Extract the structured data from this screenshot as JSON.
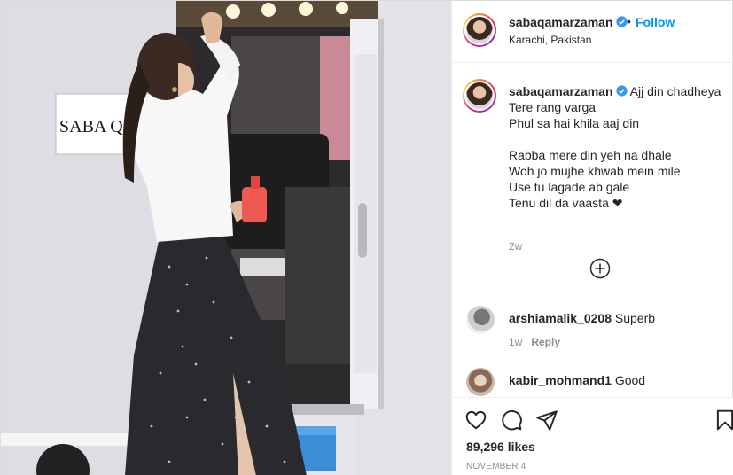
{
  "header": {
    "username": "sabaqamarzaman",
    "separator": "•",
    "follow_label": "Follow",
    "location": "Karachi, Pakistan"
  },
  "photo": {
    "sign_text": "SABA QAM"
  },
  "caption": {
    "username": "sabaqamarzaman",
    "first_line": "Ajj din chadheya",
    "lines": [
      "Tere rang varga",
      "Phul sa hai khila aaj din",
      "",
      "Rabba mere din yeh na dhale",
      "Woh jo mujhe khwab mein mile",
      "Use tu lagade ab gale",
      "Tenu dil da vaasta ❤"
    ],
    "time": "2w"
  },
  "comments": [
    {
      "username": "arshiamalik_0208",
      "text": "Superb",
      "time": "1w",
      "reply_label": "Reply"
    },
    {
      "username": "kabir_mohmand1",
      "text": "Good"
    }
  ],
  "actions": {
    "icons": [
      "heart-icon",
      "comment-icon",
      "share-icon",
      "bookmark-icon"
    ],
    "likes": "89,296 likes",
    "date": "NOVEMBER 4"
  },
  "colors": {
    "link_blue": "#0095f6",
    "verified_blue": "#3897f0",
    "meta_gray": "#8e8e8e",
    "text": "#262626",
    "border": "#efefef"
  }
}
